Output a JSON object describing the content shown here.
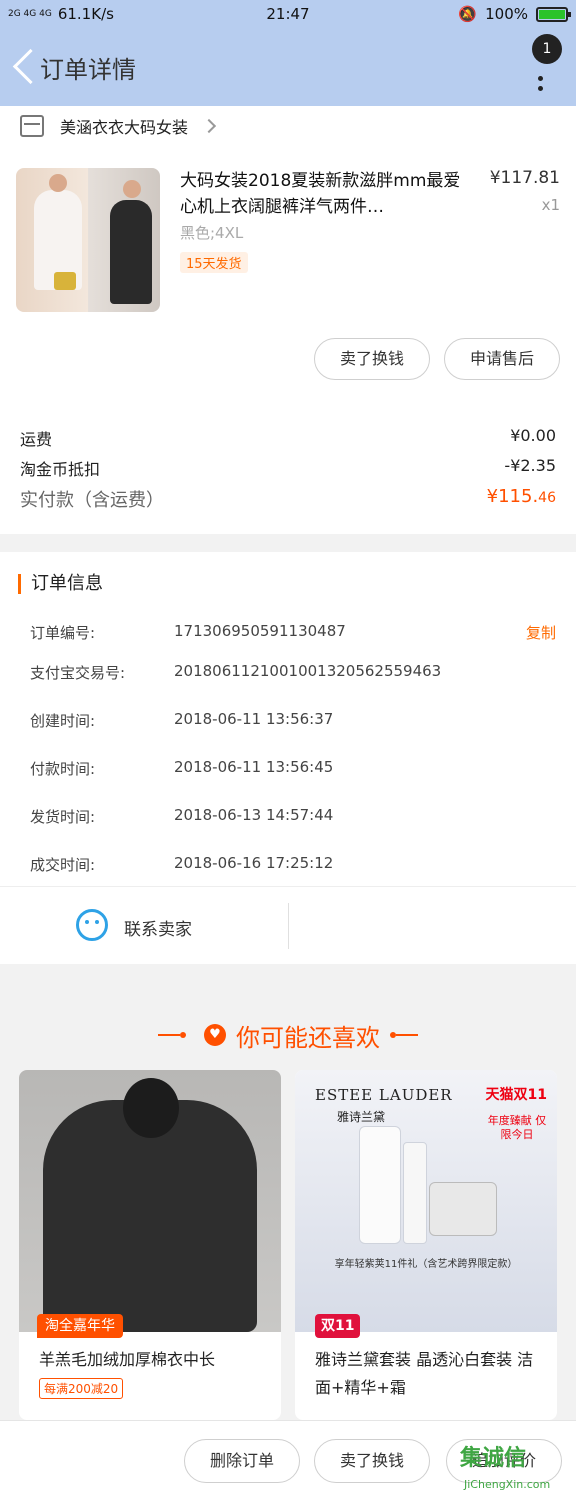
{
  "status_bar": {
    "signal": "2G 4G 4G",
    "speed": "61.1K/s",
    "time": "21:47",
    "battery": "100%"
  },
  "header": {
    "title": "订单详情",
    "badge_count": "1"
  },
  "shop": {
    "name": "美涵衣衣大码女装"
  },
  "product": {
    "title": "大码女装2018夏装新款滋胖mm最爱心机上衣阔腿裤洋气两件…",
    "price": "¥117.81",
    "qty": "x1",
    "spec": "黑色;4XL",
    "ship_tag": "15天发货",
    "btn_sell": "卖了换钱",
    "btn_after": "申请售后"
  },
  "fees": {
    "shipping_label": "运费",
    "shipping_value": "¥0.00",
    "coin_label": "淘金币抵扣",
    "coin_value": "-¥2.35",
    "total_label": "实付款（含运费）",
    "total_value_main": "¥115.",
    "total_value_cents": "46"
  },
  "order_info": {
    "title": "订单信息",
    "copy": "复制",
    "rows": [
      {
        "k": "订单编号:",
        "v": "171306950591130487"
      },
      {
        "k": "支付宝交易号:",
        "v": "2018061121001001320562559463"
      },
      {
        "k": "创建时间:",
        "v": "2018-06-11 13:56:37"
      },
      {
        "k": "付款时间:",
        "v": "2018-06-11 13:56:45"
      },
      {
        "k": "发货时间:",
        "v": "2018-06-13 14:57:44"
      },
      {
        "k": "成交时间:",
        "v": "2018-06-16 17:25:12"
      }
    ]
  },
  "contact": {
    "label": "联系卖家"
  },
  "recommend": {
    "title": "你可能还喜欢",
    "cards": [
      {
        "ribbon": "淘全嘉年华",
        "title": "羊羔毛加绒加厚棉衣中长",
        "chip": "每满200减20"
      },
      {
        "ribbon": "双11",
        "title": "雅诗兰黛套装 晶透沁白套装 洁面+精华+霜",
        "brand": "ESTEE LAUDER",
        "brand_cn": "雅诗兰黛",
        "tmall": "天猫双11",
        "badge": "年度臻献 仅限今日",
        "promo": "享年轻紫荚11件礼（含艺术跨界限定款）"
      }
    ]
  },
  "bottom": {
    "delete": "删除订单",
    "sell": "卖了换钱",
    "review": "追加评价"
  },
  "watermark": {
    "logo": "集诚信",
    "url": "JiChengXin.com"
  },
  "colors": {
    "header_bg": "#b7cdef",
    "accent": "#ff5000",
    "link": "#2ea2e6"
  }
}
